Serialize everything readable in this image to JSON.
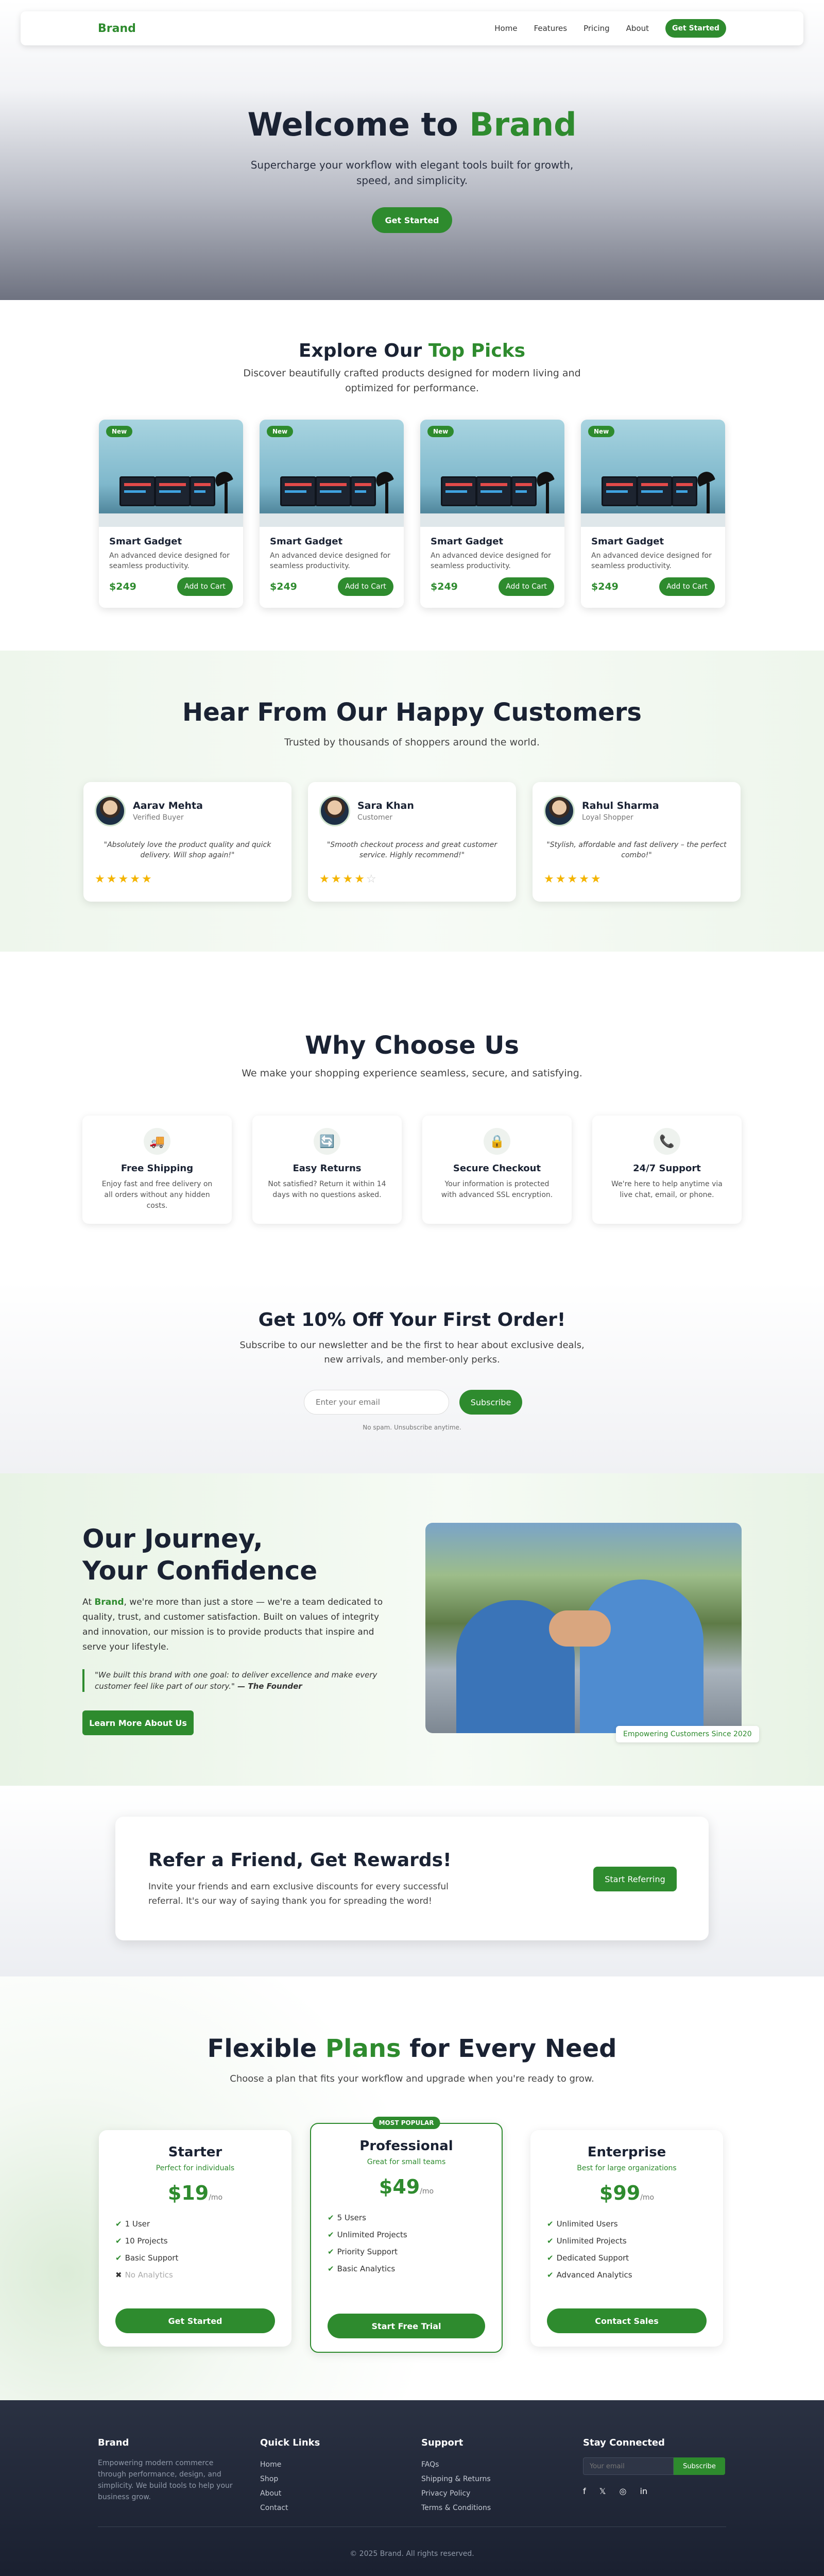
{
  "nav": {
    "brand": "Brand",
    "links": [
      "Home",
      "Features",
      "Pricing",
      "About"
    ],
    "cta": "Get Started"
  },
  "hero": {
    "title_prefix": "Welcome to ",
    "title_brand": "Brand",
    "subtitle": "Supercharge your workflow with elegant tools built for growth, speed, and simplicity.",
    "cta": "Get Started"
  },
  "picks": {
    "title_prefix": "Explore Our ",
    "title_accent": "Top Picks",
    "subtitle": "Discover beautifully crafted products designed for modern living and optimized for performance.",
    "products": [
      {
        "badge": "New",
        "name": "Smart Gadget",
        "desc": "An advanced device designed for seamless productivity.",
        "price": "$249",
        "cta": "Add to Cart"
      },
      {
        "badge": "New",
        "name": "Smart Gadget",
        "desc": "An advanced device designed for seamless productivity.",
        "price": "$249",
        "cta": "Add to Cart"
      },
      {
        "badge": "New",
        "name": "Smart Gadget",
        "desc": "An advanced device designed for seamless productivity.",
        "price": "$249",
        "cta": "Add to Cart"
      },
      {
        "badge": "New",
        "name": "Smart Gadget",
        "desc": "An advanced device designed for seamless productivity.",
        "price": "$249",
        "cta": "Add to Cart"
      }
    ]
  },
  "testimonials": {
    "title": "Hear From Our Happy Customers",
    "subtitle": "Trusted by thousands of shoppers around the world.",
    "items": [
      {
        "name": "Aarav Mehta",
        "role": "Verified Buyer",
        "quote": "\"Absolutely love the product quality and quick delivery. Will shop again!\"",
        "rating": 5
      },
      {
        "name": "Sara Khan",
        "role": "Customer",
        "quote": "\"Smooth checkout process and great customer service. Highly recommend!\"",
        "rating": 4
      },
      {
        "name": "Rahul Sharma",
        "role": "Loyal Shopper",
        "quote": "\"Stylish, affordable and fast delivery – the perfect combo!\"",
        "rating": 5
      }
    ]
  },
  "why": {
    "title": "Why Choose Us",
    "subtitle": "We make your shopping experience seamless, secure, and satisfying.",
    "features": [
      {
        "icon": "truck-icon",
        "glyph": "🚚",
        "title": "Free Shipping",
        "desc": "Enjoy fast and free delivery on all orders without any hidden costs."
      },
      {
        "icon": "returns-icon",
        "glyph": "🔄",
        "title": "Easy Returns",
        "desc": "Not satisfied? Return it within 14 days with no questions asked."
      },
      {
        "icon": "lock-icon",
        "glyph": "🔒",
        "title": "Secure Checkout",
        "desc": "Your information is protected with advanced SSL encryption."
      },
      {
        "icon": "phone-icon",
        "glyph": "📞",
        "title": "24/7 Support",
        "desc": "We're here to help anytime via live chat, email, or phone."
      }
    ]
  },
  "newsletter": {
    "title": "Get 10% Off Your First Order!",
    "subtitle": "Subscribe to our newsletter and be the first to hear about exclusive deals, new arrivals, and member-only perks.",
    "placeholder": "Enter your email",
    "cta": "Subscribe",
    "note": "No spam. Unsubscribe anytime."
  },
  "journey": {
    "title_line1": "Our Journey,",
    "title_line2": "Your Confidence",
    "text_prefix": "At ",
    "text_brand": "Brand",
    "text_body": ", we're more than just a store — we're a team dedicated to quality, trust, and customer satisfaction. Built on values of integrity and innovation, our mission is to provide products that inspire and serve your lifestyle.",
    "quote": "\"We built this brand with one goal: to deliver excellence and make every customer feel like part of our story.\"",
    "quote_author": " — The Founder",
    "cta": "Learn More About Us",
    "caption": "Empowering Customers Since 2020"
  },
  "refer": {
    "title": "Refer a Friend, Get Rewards!",
    "text": "Invite your friends and earn exclusive discounts for every successful referral. It's our way of saying thank you for spreading the word!",
    "cta": "Start Referring"
  },
  "plans": {
    "title_prefix": "Flexible ",
    "title_accent": "Plans",
    "title_suffix": " for Every Need",
    "subtitle": "Choose a plan that fits your workflow and upgrade when you're ready to grow.",
    "items": [
      {
        "name": "Starter",
        "sub": "Perfect for individuals",
        "price": "$19",
        "period": "/mo",
        "features": [
          {
            "t": "1 User",
            "on": true
          },
          {
            "t": "10 Projects",
            "on": true
          },
          {
            "t": "Basic Support",
            "on": true
          },
          {
            "t": "No Analytics",
            "on": false
          }
        ],
        "cta": "Get Started"
      },
      {
        "name": "Professional",
        "sub": "Great for small teams",
        "price": "$49",
        "period": "/mo",
        "badge": "MOST POPULAR",
        "features": [
          {
            "t": "5 Users",
            "on": true
          },
          {
            "t": "Unlimited Projects",
            "on": true
          },
          {
            "t": "Priority Support",
            "on": true
          },
          {
            "t": "Basic Analytics",
            "on": true
          }
        ],
        "cta": "Start Free Trial"
      },
      {
        "name": "Enterprise",
        "sub": "Best for large organizations",
        "price": "$99",
        "period": "/mo",
        "features": [
          {
            "t": "Unlimited Users",
            "on": true
          },
          {
            "t": "Unlimited Projects",
            "on": true
          },
          {
            "t": "Dedicated Support",
            "on": true
          },
          {
            "t": "Advanced Analytics",
            "on": true
          }
        ],
        "cta": "Contact Sales"
      }
    ]
  },
  "footer": {
    "brand": "Brand",
    "brand_desc": "Empowering modern commerce through performance, design, and simplicity. We build tools to help your business grow.",
    "quick_title": "Quick Links",
    "quick_links": [
      "Home",
      "Shop",
      "About",
      "Contact"
    ],
    "support_title": "Support",
    "support_links": [
      "FAQs",
      "Shipping & Returns",
      "Privacy Policy",
      "Terms & Conditions"
    ],
    "stay_title": "Stay Connected",
    "placeholder": "Your email",
    "cta": "Subscribe",
    "social": [
      "f",
      "𝕏",
      "◎",
      "in"
    ],
    "copyright": "© 2025 Brand. All rights reserved."
  },
  "colors": {
    "accent": "#2e8b2e",
    "dark": "#1a2233"
  }
}
